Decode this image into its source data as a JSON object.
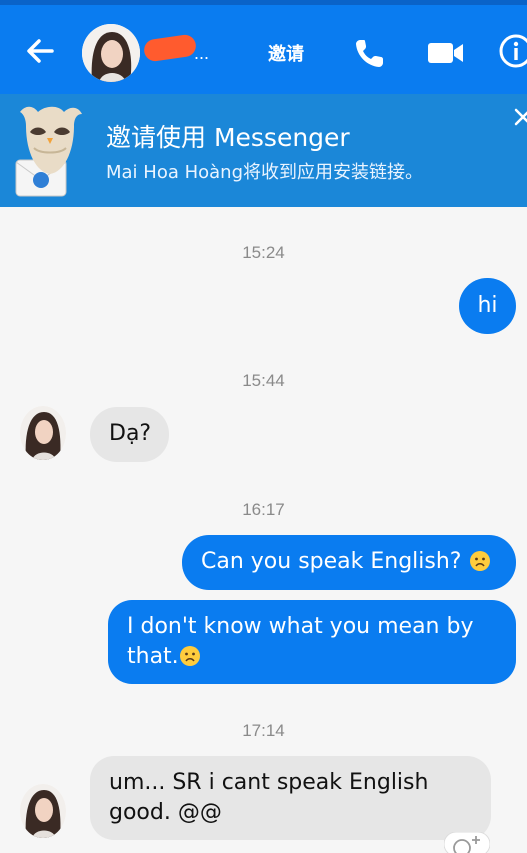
{
  "header": {
    "name_suffix": "...",
    "invite_label": "邀请"
  },
  "banner": {
    "title": "邀请使用 Messenger",
    "subtitle": "Mai Hoa Hoàng将收到应用安装链接。"
  },
  "messages": [
    {
      "type": "timestamp",
      "text": "15:24"
    },
    {
      "type": "outgoing",
      "text": "hi"
    },
    {
      "type": "timestamp",
      "text": "15:44"
    },
    {
      "type": "incoming",
      "text": "Dạ?"
    },
    {
      "type": "timestamp",
      "text": "16:17"
    },
    {
      "type": "outgoing",
      "text": "Can you speak English?"
    },
    {
      "type": "outgoing",
      "text_line1": "I don't know what you mean by",
      "text_line2": "that."
    },
    {
      "type": "timestamp",
      "text": "17:14"
    },
    {
      "type": "incoming",
      "text_line1": "um... SR i cant speak English",
      "text_line2": "good. @@"
    }
  ],
  "colors": {
    "brand_blue": "#0a7cf0",
    "banner_blue": "#1b87d8",
    "incoming_bubble": "#e6e6e6"
  }
}
